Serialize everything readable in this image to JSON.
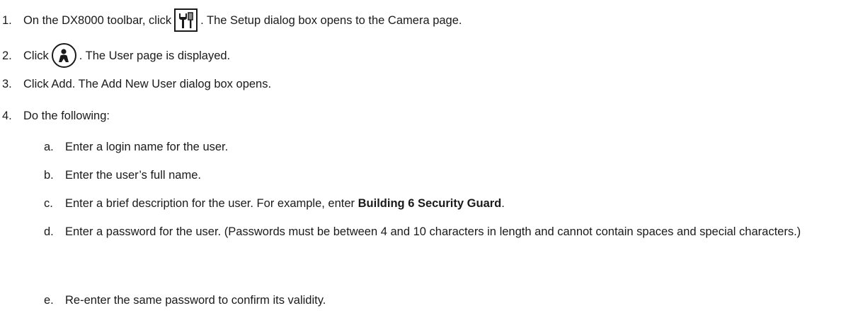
{
  "steps": [
    {
      "number": "1.",
      "text_before": "On the DX8000 toolbar, click",
      "icon": "setup-tools-icon",
      "text_after": ". The Setup dialog box opens to the Camera page."
    },
    {
      "number": "2.",
      "text_before": "Click",
      "icon": "user-icon",
      "text_after": ". The User page is displayed."
    },
    {
      "number": "3.",
      "text": "Click Add. The Add New User dialog box opens."
    },
    {
      "number": "4.",
      "text": "Do the following:"
    }
  ],
  "substeps": [
    {
      "letter": "a.",
      "text": "Enter a login name for the user."
    },
    {
      "letter": "b.",
      "text": "Enter the user’s full name."
    },
    {
      "letter": "c.",
      "text_before": "Enter a brief description for the user. For example, enter ",
      "bold": "Building 6 Security Guard",
      "text_after": "."
    },
    {
      "letter": "d.",
      "text": "Enter a password for the user. (Passwords must be between 4 and 10 characters in length and cannot contain spaces and special characters.)"
    },
    {
      "letter": "e.",
      "text": "Re-enter the same password to confirm its validity."
    }
  ]
}
